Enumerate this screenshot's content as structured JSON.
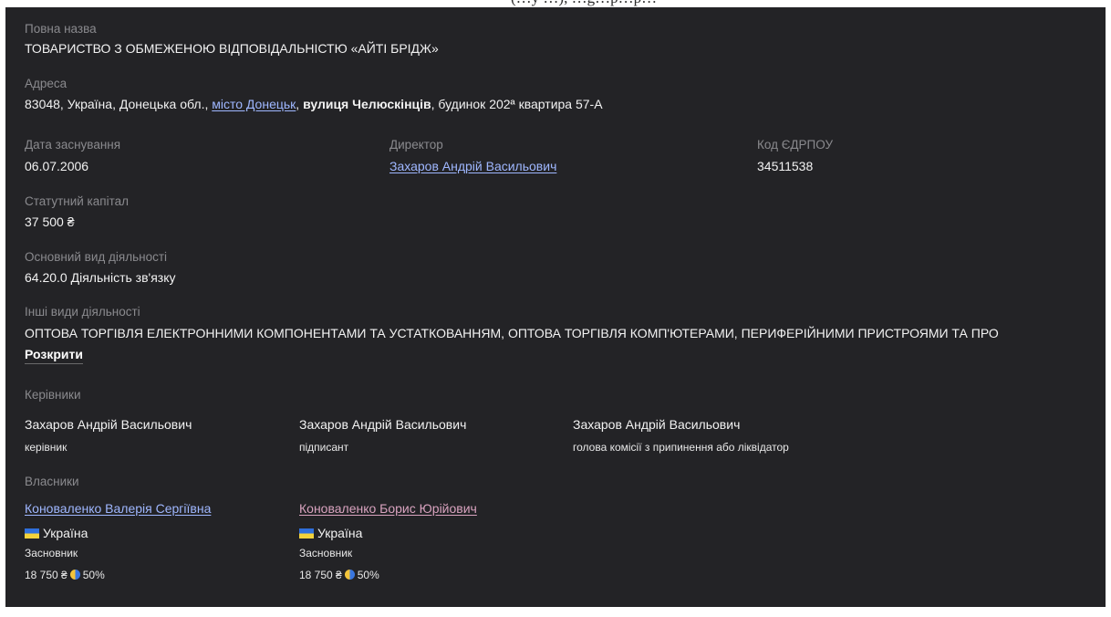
{
  "page_top_cut_text": "(…у …), …g…p…p…",
  "full_name": {
    "label": "Повна назва",
    "value": "ТОВАРИСТВО З ОБМЕЖЕНОЮ ВІДПОВІДАЛЬНІСТЮ «АЙТІ БРІДЖ»"
  },
  "address": {
    "label": "Адреса",
    "prefix": "83048, Україна, Донецька обл., ",
    "city_link": "місто Донецьк",
    "separator": ", ",
    "street": "вулиця Челюскінців",
    "rest": ", будинок 202ª квартира 57-А"
  },
  "founded": {
    "label": "Дата заснування",
    "value": "06.07.2006"
  },
  "director": {
    "label": "Директор",
    "value": "Захаров Андрій Васильович"
  },
  "edrpou": {
    "label": "Код ЄДРПОУ",
    "value": "34511538"
  },
  "capital": {
    "label": "Статутний капітал",
    "value": "37 500 ₴"
  },
  "main_activity": {
    "label": "Основний вид діяльності",
    "value": "64.20.0 Діяльність зв'язку"
  },
  "other_activities": {
    "label": "Інші види діяльності",
    "value": "ОПТОВА ТОРГІВЛЯ ЕЛЕКТРОННИМИ КОМПОНЕНТАМИ ТА УСТАТКОВАННЯМ, ОПТОВА ТОРГІВЛЯ КОМП'ЮТЕРАМИ, ПЕРИФЕРІЙНИМИ ПРИСТРОЯМИ ТА ПРО",
    "expand_label": "Розкрити"
  },
  "managers": {
    "label": "Керівники",
    "items": [
      {
        "name": "Захаров Андрій Васильович",
        "role": "керівник"
      },
      {
        "name": "Захаров Андрій Васильович",
        "role": "підписант"
      },
      {
        "name": "Захаров Андрій Васильович",
        "role": "голова комісії з припинення або ліквідатор"
      }
    ]
  },
  "owners": {
    "label": "Власники",
    "items": [
      {
        "name": "Коноваленко Валерія Сергіївна",
        "country": "Україна",
        "role": "Засновник",
        "amount": "18 750 ₴",
        "share": "50%",
        "link_color": "#9fb7ff",
        "flag_icon": "ukraine-flag-icon",
        "share_icon": "pie-share-icon"
      },
      {
        "name": "Коноваленко Борис Юрійович",
        "country": "Україна",
        "role": "Засновник",
        "amount": "18 750 ₴",
        "share": "50%",
        "link_color": "#d9a3bf",
        "flag_icon": "ukraine-flag-icon",
        "share_icon": "pie-share-icon"
      }
    ]
  },
  "colors": {
    "background": "#232326",
    "label": "#8a8a8e",
    "link_blue": "#9fb7ff",
    "link_pink": "#d9a3bf"
  }
}
